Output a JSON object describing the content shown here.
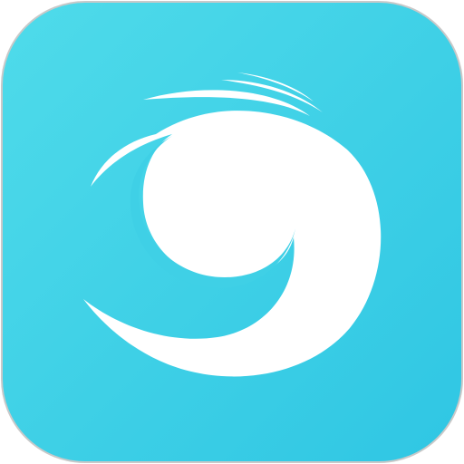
{
  "app_icon": {
    "icon_name": "swirl-eye-logo-icon",
    "colors": {
      "background_top": "#4fdbea",
      "background_bottom": "#2fc6e3",
      "border": "#c9c9c9",
      "mark": "#ffffff"
    }
  }
}
